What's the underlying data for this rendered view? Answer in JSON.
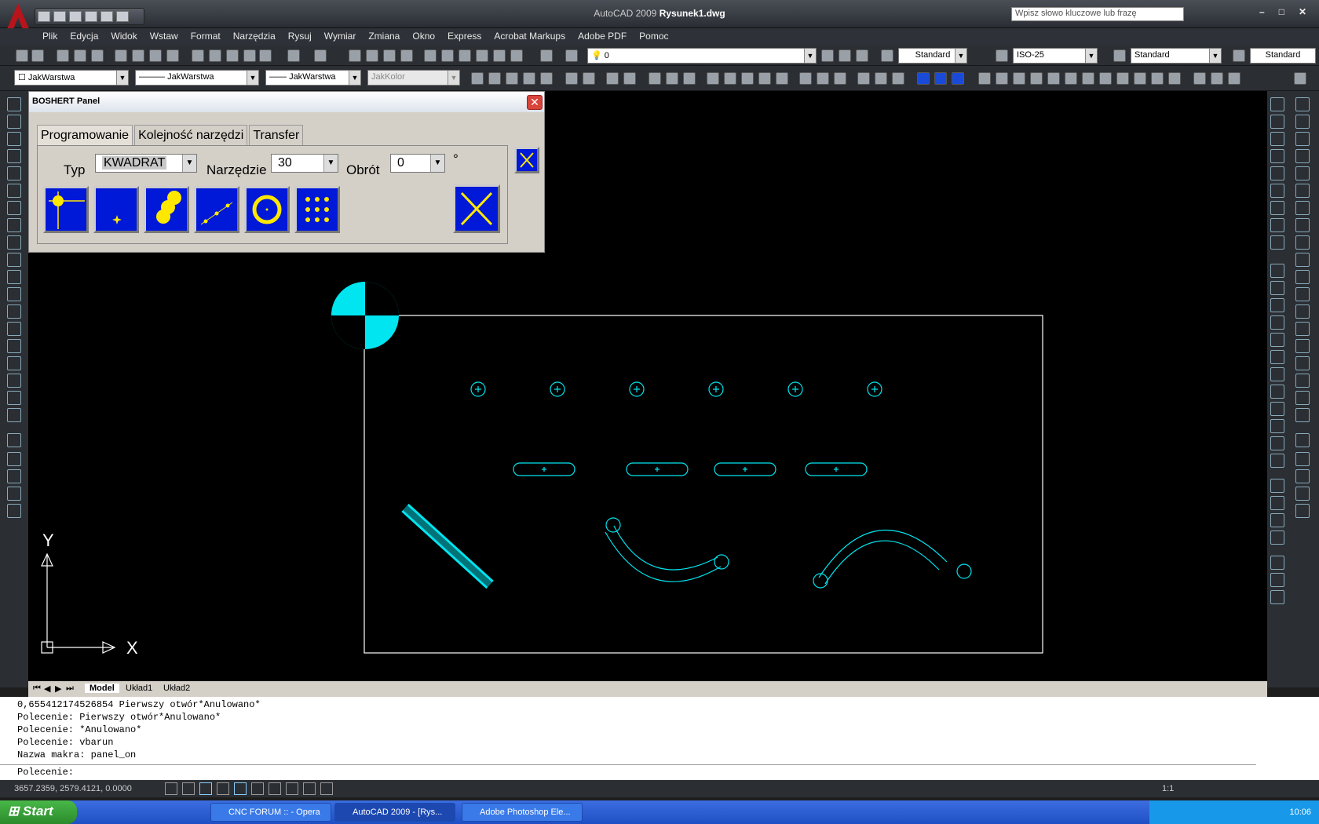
{
  "window": {
    "app_name": "AutoCAD 2009",
    "document": "Rysunek1.dwg",
    "search_placeholder": "Wpisz słowo kluczowe lub frazę"
  },
  "menu": [
    "Plik",
    "Edycja",
    "Widok",
    "Wstaw",
    "Format",
    "Narzędzia",
    "Rysuj",
    "Wymiar",
    "Zmiana",
    "Okno",
    "Express",
    "Acrobat Markups",
    "Adobe PDF",
    "Pomoc"
  ],
  "toolbar1": {
    "layer": "0",
    "text_style": "Standard",
    "dim_style": "ISO-25",
    "table_style": "Standard",
    "multileader_style": "Standard"
  },
  "toolbar2": {
    "layer_color": "JakWarstwa",
    "linetype": "JakWarstwa",
    "lineweight": "JakWarstwa",
    "plot_style": "JakKolor"
  },
  "panel": {
    "title": "BOSHERT Panel",
    "tabs": [
      "Programowanie",
      "Kolejność narzędzi",
      "Transfer"
    ],
    "typ_label": "Typ",
    "typ_value": "KWADRAT",
    "tool_label": "Narzędzie",
    "tool_value": "30",
    "rot_label": "Obrót",
    "rot_value": "0",
    "deg": "°"
  },
  "ucs": {
    "x": "X",
    "y": "Y"
  },
  "layout_tabs": [
    "Model",
    "Układ1",
    "Układ2"
  ],
  "command_lines": [
    "0,655412174526854                 Pierwszy otwór*Anulowano*",
    "Polecenie:  Pierwszy otwór*Anulowano*",
    "Polecenie: *Anulowano*",
    "Polecenie: vbarun",
    "Nazwa makra: panel_on"
  ],
  "command_prompt": "Polecenie:",
  "status": {
    "coords": "3657.2359, 2579.4121, 0.0000",
    "scale": "1:1"
  },
  "taskbar": {
    "start": "Start",
    "tasks": [
      "CNC FORUM :: - Opera",
      "AutoCAD 2009 - [Rys...",
      "Adobe Photoshop Ele..."
    ],
    "clock": "10:06"
  },
  "colors": {
    "drawing": "#00e5f0",
    "background": "#000000",
    "button_blue": "#0018d8",
    "button_yellow": "#ffe800"
  }
}
